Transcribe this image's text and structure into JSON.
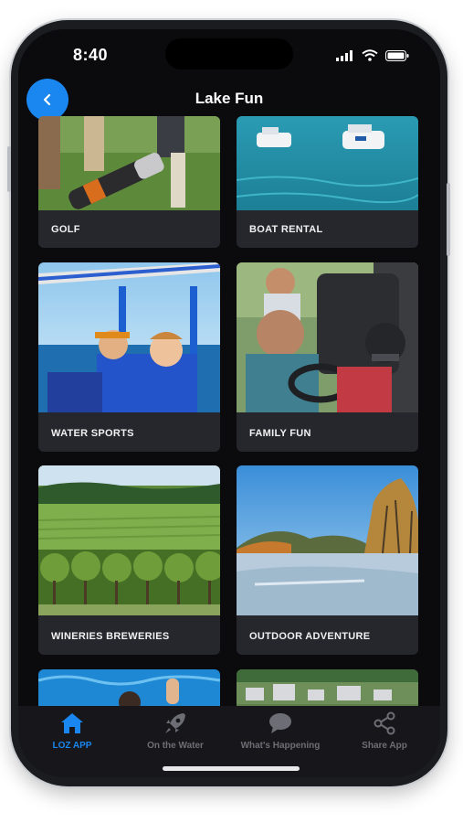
{
  "status_bar": {
    "time": "8:40"
  },
  "header": {
    "title": "Lake Fun"
  },
  "categories": [
    {
      "label": "GOLF"
    },
    {
      "label": "BOAT RENTAL"
    },
    {
      "label": "WATER SPORTS"
    },
    {
      "label": "FAMILY FUN"
    },
    {
      "label": "WINERIES BREWERIES"
    },
    {
      "label": "OUTDOOR ADVENTURE"
    }
  ],
  "tabs": [
    {
      "label": "LOZ APP",
      "icon": "home-icon",
      "active": true
    },
    {
      "label": "On the Water",
      "icon": "rocket-icon",
      "active": false
    },
    {
      "label": "What's Happening",
      "icon": "chat-bubble-icon",
      "active": false
    },
    {
      "label": "Share App",
      "icon": "share-icon",
      "active": false
    }
  ],
  "colors": {
    "accent": "#1a86f0",
    "background": "#0b0b0e",
    "card": "#26262d",
    "tab_bar": "#17171b",
    "tab_inactive": "#6d6e75"
  }
}
